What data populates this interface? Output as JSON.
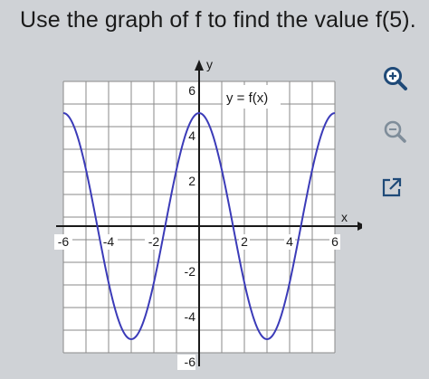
{
  "question": {
    "text": "Use the graph of f to find the value f(5)."
  },
  "graph": {
    "function_label": "y = f(x)",
    "x_axis_label": "x",
    "y_axis_label": "y",
    "x_tick_labels": [
      "-6",
      "-4",
      "-2",
      "2",
      "4",
      "6"
    ],
    "y_tick_labels": [
      "6",
      "4",
      "2",
      "-2",
      "-4",
      "-6"
    ],
    "curve_color": "#3b3bb8",
    "curve_amplitude": 5,
    "curve_period": 6,
    "x_range": [
      -6,
      6
    ],
    "y_range": [
      -6,
      6
    ]
  },
  "toolbar": {
    "zoom_in_icon": "zoom-in-icon",
    "zoom_out_icon": "zoom-out-icon",
    "popout_icon": "external-link-icon",
    "accent_color": "#1f4a78"
  }
}
